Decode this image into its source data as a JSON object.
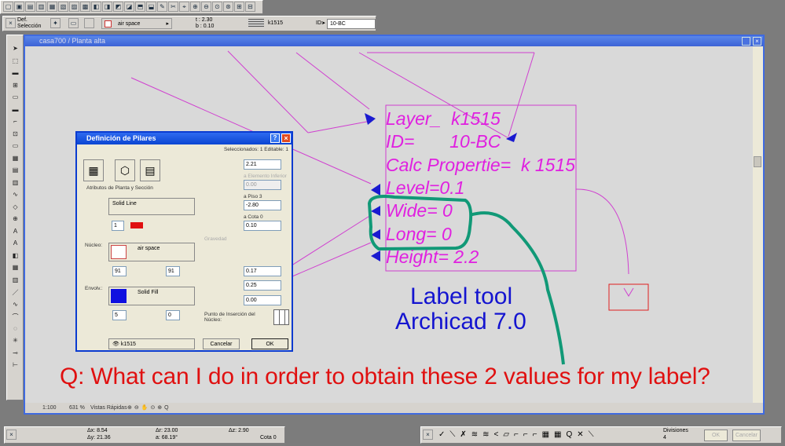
{
  "toolbar": {
    "selection_label": "Def.\nSelección",
    "fill": "air space",
    "top": "t : 2.30",
    "bottom": "b : 0.10",
    "layer": "k1515",
    "id_label": "ID:",
    "id_value": "10-BC"
  },
  "window": {
    "title": "casa700 / Planta alta"
  },
  "status": {
    "scale": "1:100",
    "zoom": "631 %",
    "views": "Vistas Rápidas"
  },
  "label": {
    "lines": [
      "Layer_  k1515",
      "ID=       10-BC",
      "Calc Propertie=  k 1515",
      "Level=0.1",
      "Wide= 0",
      "Long= 0",
      "Height= 2.2"
    ]
  },
  "caption": {
    "line1": "Label tool",
    "line2": "Archicad 7.0"
  },
  "question": "Q: What can I do in order to obtain these 2 values for my label?",
  "dialog": {
    "title": "Definición de Pilares",
    "selected": "Seleccionados: 1 Editable: 1",
    "section": "Atributos de Planta y Sección",
    "line_type": "Solid Line",
    "pen1": "1",
    "core_label": "Núcleo:",
    "core_fill": "air space",
    "pen_a": "91",
    "pen_b": "91",
    "wrap_label": "Envolv.:",
    "wrap_fill": "Solid Fill",
    "pen_c": "5",
    "pen_d": "0",
    "height": "2.21",
    "to_lower_label": "a Elemento Inferior",
    "to_lower": "0.00",
    "floor_label": "a Piso 3",
    "floor": "-2.80",
    "elev_label": "a Cota 0",
    "elev": "0.10",
    "gravity": "Gravedad",
    "v1": "0.17",
    "v2": "0.25",
    "v3": "0.00",
    "insertion": "Punto de Inserción del Núcleo:",
    "layer": "k1515",
    "cancel": "Cancelar",
    "ok": "OK"
  },
  "coords": {
    "dx": "Δx: 8.54",
    "dy": "Δy: 21.36",
    "dr": "Δr: 23.00",
    "a": "a: 68.19°",
    "dz": "Δz: 2.90",
    "cota": "Cota 0"
  },
  "control": {
    "divisions_label": "Divisiones",
    "divisions": "4",
    "ok": "OK",
    "cancel": "Cancelar"
  },
  "colors": {
    "label": "#e020e0",
    "caption": "#1414d0",
    "question": "#e01010",
    "highlight": "#119977"
  }
}
